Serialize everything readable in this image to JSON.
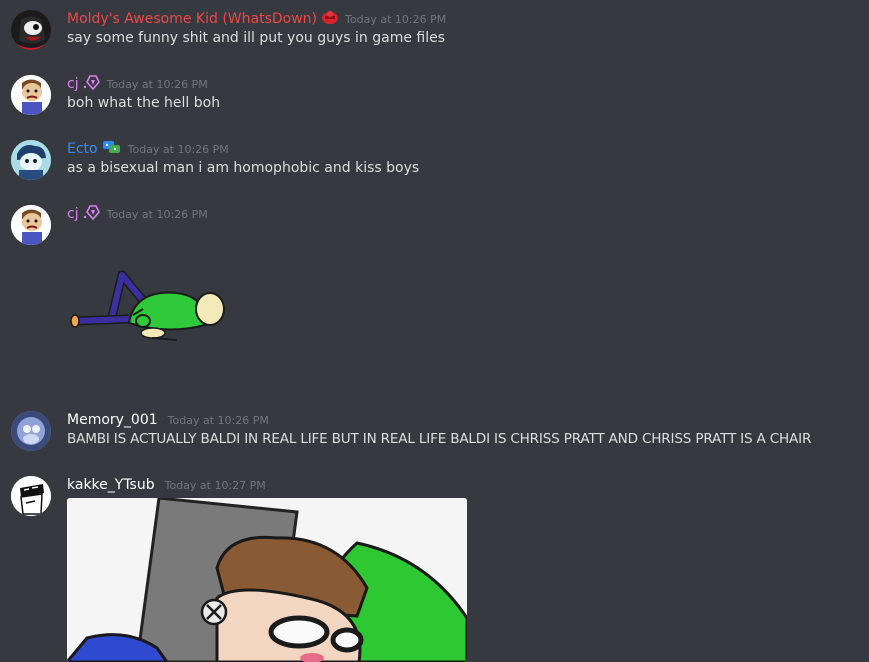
{
  "messages": [
    {
      "username": "Moldy's Awesome Kid (WhatsDown)",
      "color": "#f04747",
      "badge": "red-hat-icon",
      "timestamp": "Today at 10:26 PM",
      "text": "say some funny shit and ill put you guys in game files"
    },
    {
      "username": "cj",
      "color": "#da7ff0",
      "badge": "purple-gem-icon",
      "timestamp": "Today at 10:26 PM",
      "text": "boh what the hell boh"
    },
    {
      "username": "Ecto",
      "color": "#3b8bf5",
      "badge": "blue-green-icon",
      "timestamp": "Today at 10:26 PM",
      "text": "as a bisexual man i am homophobic and kiss boys"
    },
    {
      "username": "cj",
      "color": "#da7ff0",
      "badge": "purple-gem-icon",
      "timestamp": "Today at 10:26 PM",
      "text": ""
    },
    {
      "username": "Memory_001",
      "color": "#ffffff",
      "badge": "",
      "timestamp": "Today at 10:26 PM",
      "text": "BAMBI IS ACTUALLY BALDI IN REAL LIFE BUT IN REAL LIFE BALDI IS CHRISS PRATT AND CHRISS PRATT IS A CHAIR"
    },
    {
      "username": "kakke_YTsub",
      "color": "#ffffff",
      "badge": "",
      "timestamp": "Today at 10:27 PM",
      "text": ""
    }
  ]
}
